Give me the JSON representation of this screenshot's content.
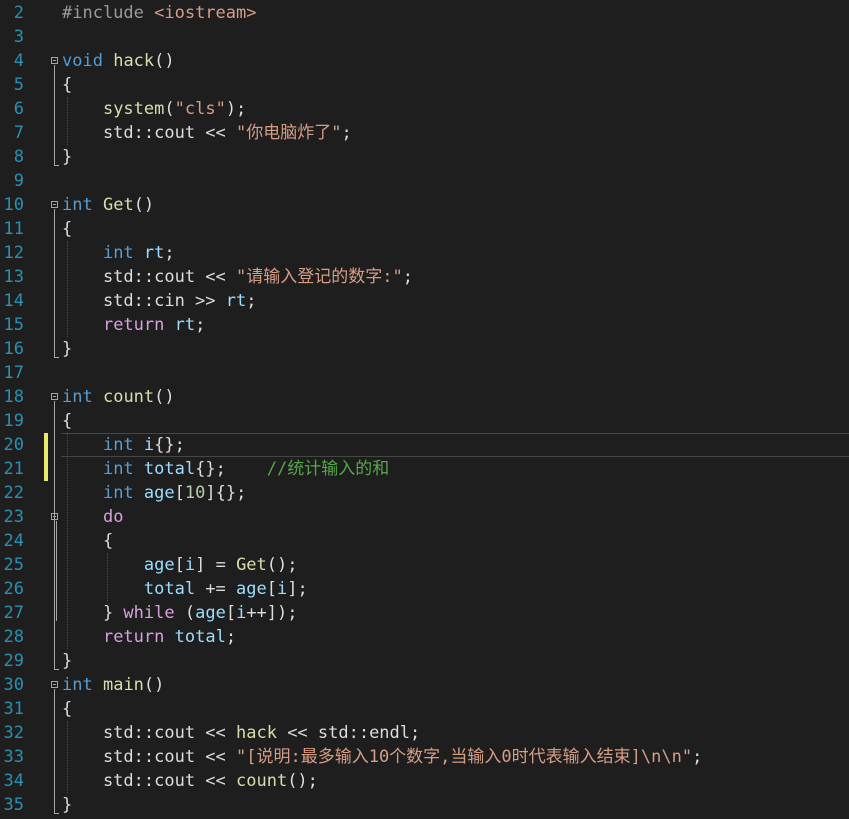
{
  "theme": {
    "background": "#1e1e1e",
    "line_number": "#2b91af",
    "keyword": "#569cd6",
    "control_keyword": "#d8a0df",
    "function": "#dcdcaa",
    "variable": "#9cdcfe",
    "string": "#d69d85",
    "comment": "#57a64a",
    "number": "#b5cea8",
    "preprocessor": "#9b9b9b",
    "include_path": "#d69d85",
    "text": "#dcdcdc",
    "change_marker": "#e9e96d"
  },
  "lines": [
    {
      "n": "2",
      "tokens": [
        {
          "t": "#include ",
          "c": "preprocessor"
        },
        {
          "t": "<iostream>",
          "c": "include_path"
        }
      ]
    },
    {
      "n": "3",
      "tokens": []
    },
    {
      "n": "4",
      "fold": true,
      "tokens": [
        {
          "t": "void",
          "c": "keyword"
        },
        {
          "t": " "
        },
        {
          "t": "hack",
          "c": "function"
        },
        {
          "t": "()"
        }
      ]
    },
    {
      "n": "5",
      "tokens": [
        {
          "t": "{"
        }
      ]
    },
    {
      "n": "6",
      "tokens": [
        {
          "t": "    "
        },
        {
          "t": "system",
          "c": "function"
        },
        {
          "t": "("
        },
        {
          "t": "\"cls\"",
          "c": "string"
        },
        {
          "t": ");"
        }
      ]
    },
    {
      "n": "7",
      "tokens": [
        {
          "t": "    std::cout << "
        },
        {
          "t": "\"你电脑炸了\"",
          "c": "string"
        },
        {
          "t": ";"
        }
      ]
    },
    {
      "n": "8",
      "tokens": [
        {
          "t": "}"
        }
      ]
    },
    {
      "n": "9",
      "tokens": []
    },
    {
      "n": "10",
      "fold": true,
      "tokens": [
        {
          "t": "int",
          "c": "keyword"
        },
        {
          "t": " "
        },
        {
          "t": "Get",
          "c": "function"
        },
        {
          "t": "()"
        }
      ]
    },
    {
      "n": "11",
      "tokens": [
        {
          "t": "{"
        }
      ]
    },
    {
      "n": "12",
      "tokens": [
        {
          "t": "    "
        },
        {
          "t": "int",
          "c": "keyword"
        },
        {
          "t": " "
        },
        {
          "t": "rt",
          "c": "variable"
        },
        {
          "t": ";"
        }
      ]
    },
    {
      "n": "13",
      "tokens": [
        {
          "t": "    std::cout << "
        },
        {
          "t": "\"请输入登记的数字:\"",
          "c": "string"
        },
        {
          "t": ";"
        }
      ]
    },
    {
      "n": "14",
      "tokens": [
        {
          "t": "    std::cin >> "
        },
        {
          "t": "rt",
          "c": "variable"
        },
        {
          "t": ";"
        }
      ]
    },
    {
      "n": "15",
      "tokens": [
        {
          "t": "    "
        },
        {
          "t": "return",
          "c": "control_keyword"
        },
        {
          "t": " "
        },
        {
          "t": "rt",
          "c": "variable"
        },
        {
          "t": ";"
        }
      ]
    },
    {
      "n": "16",
      "tokens": [
        {
          "t": "}"
        }
      ]
    },
    {
      "n": "17",
      "tokens": []
    },
    {
      "n": "18",
      "fold": true,
      "tokens": [
        {
          "t": "int",
          "c": "keyword"
        },
        {
          "t": " "
        },
        {
          "t": "count",
          "c": "function"
        },
        {
          "t": "()"
        }
      ]
    },
    {
      "n": "19",
      "tokens": [
        {
          "t": "{"
        }
      ]
    },
    {
      "n": "20",
      "current": true,
      "changed": true,
      "tokens": [
        {
          "t": "    "
        },
        {
          "t": "int",
          "c": "keyword"
        },
        {
          "t": " "
        },
        {
          "t": "i",
          "c": "variable"
        },
        {
          "t": "{};"
        }
      ]
    },
    {
      "n": "21",
      "changed": true,
      "tokens": [
        {
          "t": "    "
        },
        {
          "t": "int",
          "c": "keyword"
        },
        {
          "t": " "
        },
        {
          "t": "total",
          "c": "variable"
        },
        {
          "t": "{};    "
        },
        {
          "t": "//统计输入的和",
          "c": "comment"
        }
      ]
    },
    {
      "n": "22",
      "tokens": [
        {
          "t": "    "
        },
        {
          "t": "int",
          "c": "keyword"
        },
        {
          "t": " "
        },
        {
          "t": "age",
          "c": "variable"
        },
        {
          "t": "["
        },
        {
          "t": "10",
          "c": "number"
        },
        {
          "t": "]{};"
        }
      ]
    },
    {
      "n": "23",
      "fold": true,
      "tokens": [
        {
          "t": "    "
        },
        {
          "t": "do",
          "c": "control_keyword"
        }
      ]
    },
    {
      "n": "24",
      "tokens": [
        {
          "t": "    {"
        }
      ]
    },
    {
      "n": "25",
      "tokens": [
        {
          "t": "        "
        },
        {
          "t": "age",
          "c": "variable"
        },
        {
          "t": "["
        },
        {
          "t": "i",
          "c": "variable"
        },
        {
          "t": "] = "
        },
        {
          "t": "Get",
          "c": "function"
        },
        {
          "t": "();"
        }
      ]
    },
    {
      "n": "26",
      "tokens": [
        {
          "t": "        "
        },
        {
          "t": "total",
          "c": "variable"
        },
        {
          "t": " += "
        },
        {
          "t": "age",
          "c": "variable"
        },
        {
          "t": "["
        },
        {
          "t": "i",
          "c": "variable"
        },
        {
          "t": "];"
        }
      ]
    },
    {
      "n": "27",
      "tokens": [
        {
          "t": "    } "
        },
        {
          "t": "while",
          "c": "control_keyword"
        },
        {
          "t": " ("
        },
        {
          "t": "age",
          "c": "variable"
        },
        {
          "t": "["
        },
        {
          "t": "i",
          "c": "variable"
        },
        {
          "t": "++]);"
        }
      ]
    },
    {
      "n": "28",
      "tokens": [
        {
          "t": "    "
        },
        {
          "t": "return",
          "c": "control_keyword"
        },
        {
          "t": " "
        },
        {
          "t": "total",
          "c": "variable"
        },
        {
          "t": ";"
        }
      ]
    },
    {
      "n": "29",
      "tokens": [
        {
          "t": "}"
        }
      ]
    },
    {
      "n": "30",
      "fold": true,
      "tokens": [
        {
          "t": "int",
          "c": "keyword"
        },
        {
          "t": " "
        },
        {
          "t": "main",
          "c": "function"
        },
        {
          "t": "()"
        }
      ]
    },
    {
      "n": "31",
      "tokens": [
        {
          "t": "{"
        }
      ]
    },
    {
      "n": "32",
      "tokens": [
        {
          "t": "    std::cout << "
        },
        {
          "t": "hack",
          "c": "function"
        },
        {
          "t": " << std::endl;"
        }
      ]
    },
    {
      "n": "33",
      "tokens": [
        {
          "t": "    std::cout << "
        },
        {
          "t": "\"[说明:最多输入10个数字,当输入0时代表输入结束]\\n\\n\"",
          "c": "string"
        },
        {
          "t": ";"
        }
      ]
    },
    {
      "n": "34",
      "tokens": [
        {
          "t": "    std::cout << "
        },
        {
          "t": "count",
          "c": "function"
        },
        {
          "t": "();"
        }
      ]
    },
    {
      "n": "35",
      "tokens": [
        {
          "t": "}"
        }
      ]
    }
  ]
}
